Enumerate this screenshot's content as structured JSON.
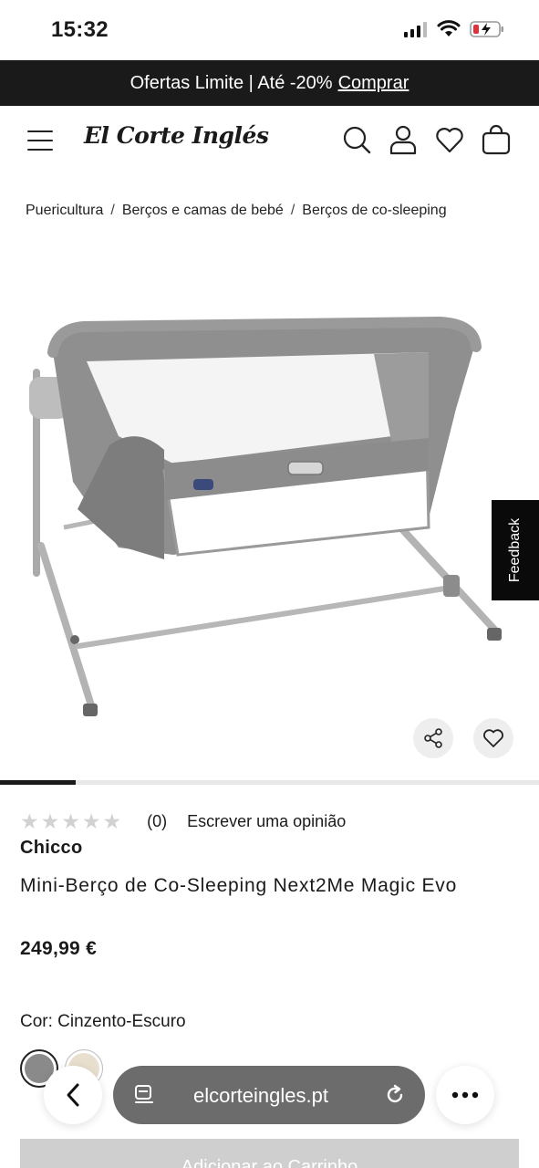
{
  "status_bar": {
    "time": "15:32"
  },
  "promo": {
    "text": "Ofertas Limite | Até -20%",
    "link": "Comprar"
  },
  "header": {
    "logo": "El Corte Inglés"
  },
  "breadcrumb": [
    "Puericultura",
    "Berços e camas de bebé",
    "Berços de co-sleeping"
  ],
  "feedback": {
    "label": "Feedback"
  },
  "product": {
    "rating_count": "(0)",
    "review_link": "Escrever uma opinião",
    "brand": "Chicco",
    "title": "Mini-Berço de Co-Sleeping Next2Me Magic Evo",
    "price": "249,99 €",
    "color_label": "Cor: Cinzento-Escuro",
    "swatches": [
      "#8a8a8a",
      "#e9dfcf"
    ],
    "add_to_cart": "Adicionar ao Carrinho",
    "gallery_progress": 0.14
  },
  "browser": {
    "url": "elcorteingles.pt"
  },
  "icons": [
    "menu-icon",
    "search-icon",
    "user-icon",
    "heart-icon",
    "bag-icon",
    "share-icon",
    "back-chevron-icon",
    "reader-icon",
    "reload-icon",
    "more-icon"
  ]
}
